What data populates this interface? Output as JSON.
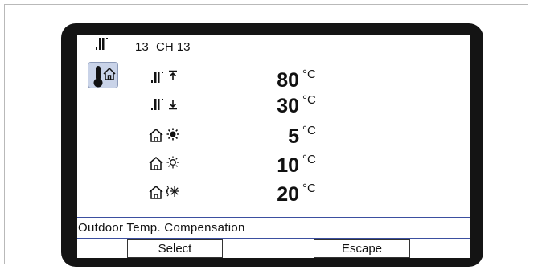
{
  "header": {
    "channel_number": "13",
    "channel_name": "CH 13",
    "icon": "radiator-icon"
  },
  "rows": [
    {
      "name": "heating-curve-max-flow",
      "icons": [
        "radiator-icon",
        "arrow-up-bar-icon"
      ],
      "value": "80",
      "unit": "°C"
    },
    {
      "name": "heating-curve-min-flow",
      "icons": [
        "radiator-icon",
        "arrow-down-bar-icon"
      ],
      "value": "30",
      "unit": "°C"
    },
    {
      "name": "outdoor-low",
      "icons": [
        "house-icon",
        "sun-filled-icon"
      ],
      "value": "5",
      "unit": "°C"
    },
    {
      "name": "outdoor-mid",
      "icons": [
        "house-icon",
        "sun-outline-icon"
      ],
      "value": "10",
      "unit": "°C"
    },
    {
      "name": "outdoor-high",
      "icons": [
        "house-icon",
        "snow-sun-icon"
      ],
      "value": "20",
      "unit": "°C"
    }
  ],
  "status_text": "Outdoor Temp. Compensation",
  "buttons": {
    "select_label": "Select",
    "escape_label": "Escape"
  },
  "colors": {
    "bezel": "#141414",
    "divider": "#3b4fa0",
    "selected_icon_bg": "#c9d3e8"
  }
}
